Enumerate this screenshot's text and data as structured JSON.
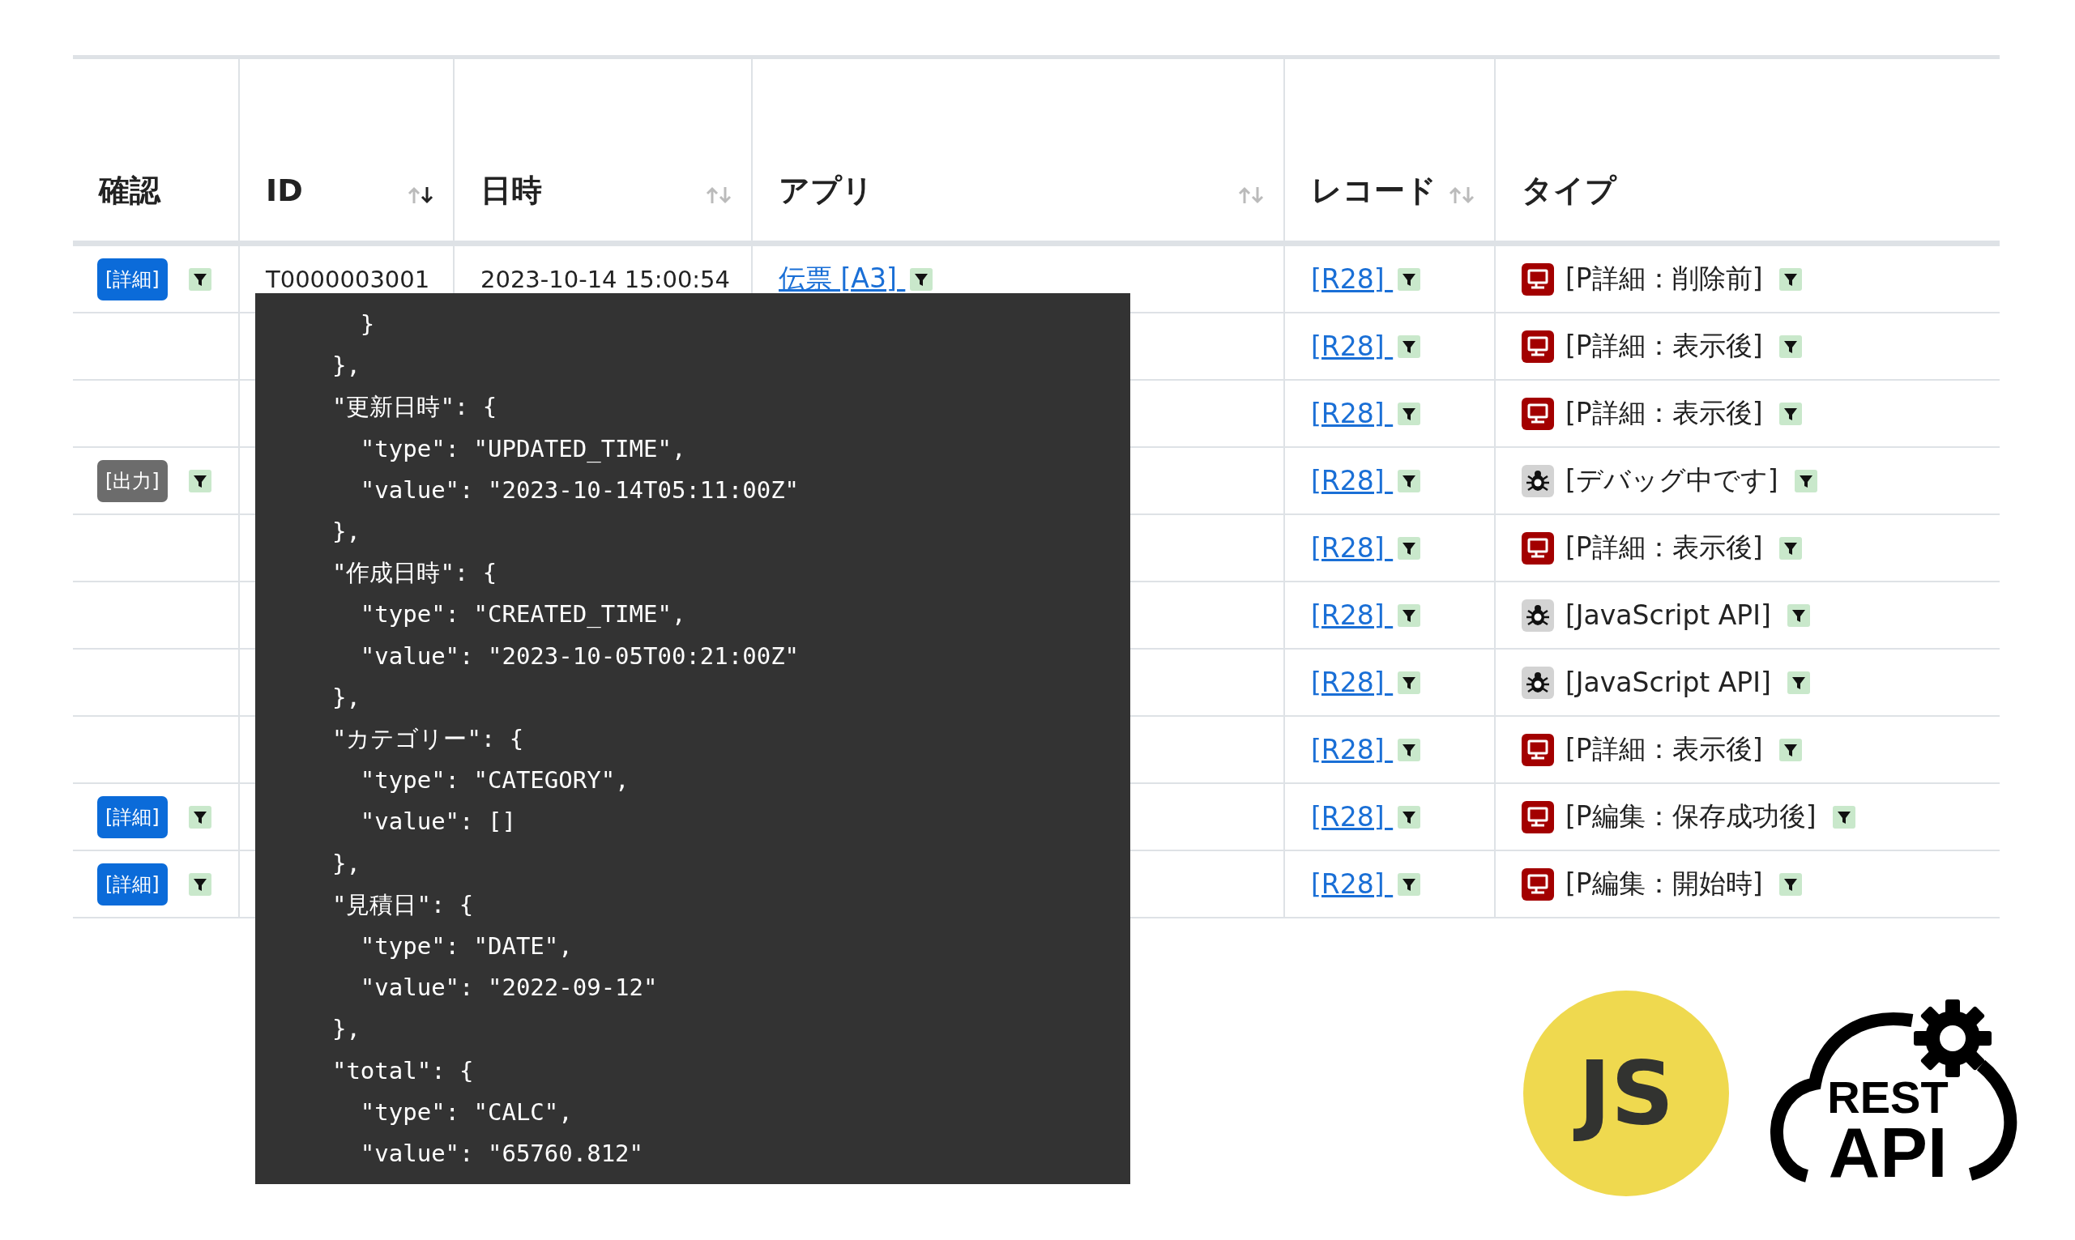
{
  "table": {
    "columns": [
      {
        "label": "確認"
      },
      {
        "label": "ID",
        "sorted": true
      },
      {
        "label": "日時",
        "sorted": false
      },
      {
        "label": "アプリ",
        "sorted": false
      },
      {
        "label": "レコード",
        "sorted": false
      },
      {
        "label": "タイプ"
      }
    ],
    "rows": [
      {
        "action": {
          "kind": "detail",
          "label": "[詳細]"
        },
        "id": "T0000003001",
        "datetime": "2023-10-14 15:00:54",
        "app": "伝票 [A3]",
        "record": "[R28]",
        "kind": "screen",
        "type": "[P詳細：削除前]"
      },
      {
        "record": "[R28]",
        "kind": "screen",
        "type": "[P詳細：表示後]"
      },
      {
        "record": "[R28]",
        "kind": "screen",
        "type": "[P詳細：表示後]"
      },
      {
        "action": {
          "kind": "output",
          "label": "[出力]"
        },
        "record": "[R28]",
        "kind": "bug",
        "type": "[デバッグ中です]"
      },
      {
        "record": "[R28]",
        "kind": "screen",
        "type": "[P詳細：表示後]"
      },
      {
        "record": "[R28]",
        "kind": "bug",
        "type": "[JavaScript API]"
      },
      {
        "record": "[R28]",
        "kind": "bug",
        "type": "[JavaScript API]"
      },
      {
        "record": "[R28]",
        "kind": "screen",
        "type": "[P詳細：表示後]"
      },
      {
        "action": {
          "kind": "detail",
          "label": "[詳細]"
        },
        "record": "[R28]",
        "kind": "screen",
        "type": "[P編集：保存成功後]"
      },
      {
        "action": {
          "kind": "detail",
          "label": "[詳細]"
        },
        "record": "[R28]",
        "kind": "screen",
        "type": "[P編集：開始時]"
      }
    ]
  },
  "code_overlay": {
    "lines": [
      "    }",
      "  },",
      "  \"更新日時\": {",
      "    \"type\": \"UPDATED_TIME\",",
      "    \"value\": \"2023-10-14T05:11:00Z\"",
      "  },",
      "  \"作成日時\": {",
      "    \"type\": \"CREATED_TIME\",",
      "    \"value\": \"2023-10-05T00:21:00Z\"",
      "  },",
      "  \"カテゴリー\": {",
      "    \"type\": \"CATEGORY\",",
      "    \"value\": []",
      "  },",
      "  \"見積日\": {",
      "    \"type\": \"DATE\",",
      "    \"value\": \"2022-09-12\"",
      "  },",
      "  \"total\": {",
      "    \"type\": \"CALC\",",
      "    \"value\": \"65760.812\""
    ]
  },
  "logos": [
    {
      "kind": "js",
      "lines": [
        "JS"
      ]
    },
    {
      "kind": "rest",
      "lines": [
        "REST",
        "API"
      ]
    }
  ]
}
